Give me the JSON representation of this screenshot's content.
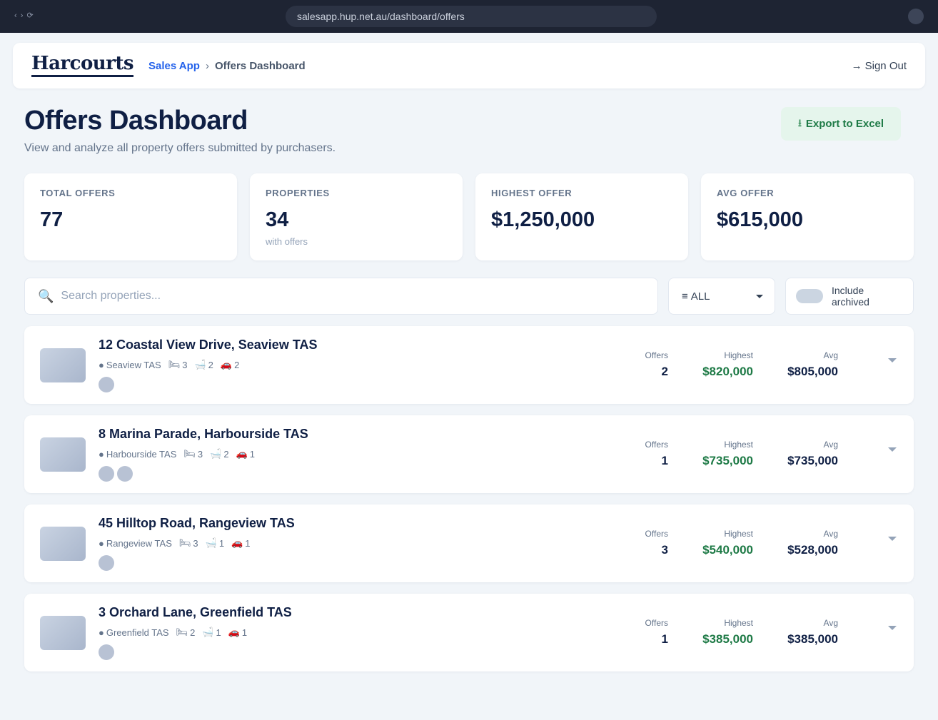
{
  "browser": {
    "nav": "‹ › ⟳",
    "url": "salesapp.hup.net.au/dashboard/offers"
  },
  "header": {
    "logo": "Harcourts",
    "breadcrumb": {
      "root": "Sales App",
      "separator": "›",
      "current": "Offers Dashboard"
    },
    "signout_icon": "→",
    "signout_label": "Sign Out"
  },
  "page": {
    "title": "Offers Dashboard",
    "subtitle": "View and analyze all property offers submitted by purchasers.",
    "export_icon": "⭳",
    "export_label": "Export to Excel"
  },
  "stats": [
    {
      "label": "Total Offers",
      "value": "77",
      "sub": ""
    },
    {
      "label": "Properties",
      "value": "34",
      "sub": "with offers"
    },
    {
      "label": "Highest Offer",
      "value": "$1,250,000",
      "sub": ""
    },
    {
      "label": "Avg Offer",
      "value": "$615,000",
      "sub": ""
    }
  ],
  "search": {
    "icon": "🔍",
    "placeholder": "Search properties...",
    "value": ""
  },
  "filter": {
    "icon": "≡",
    "selected": "ALL"
  },
  "archived": {
    "label": "Include archived",
    "enabled": false
  },
  "metric_labels": {
    "offers": "Offers",
    "highest": "Highest",
    "avg": "Avg"
  },
  "icons": {
    "bed": "🛏",
    "bath": "🛁",
    "car": "🚗",
    "suburb_dot": "●"
  },
  "properties": [
    {
      "title": "12 Coastal View Drive, Seaview TAS",
      "suburb": "Seaview TAS",
      "beds": "3",
      "baths": "2",
      "cars": "2",
      "offers": "2",
      "highest": "$820,000",
      "avg": "$805,000",
      "agents": 1
    },
    {
      "title": "8 Marina Parade, Harbourside TAS",
      "suburb": "Harbourside TAS",
      "beds": "3",
      "baths": "2",
      "cars": "1",
      "offers": "1",
      "highest": "$735,000",
      "avg": "$735,000",
      "agents": 2
    },
    {
      "title": "45 Hilltop Road, Rangeview TAS",
      "suburb": "Rangeview TAS",
      "beds": "3",
      "baths": "1",
      "cars": "1",
      "offers": "3",
      "highest": "$540,000",
      "avg": "$528,000",
      "agents": 1
    },
    {
      "title": "3 Orchard Lane, Greenfield TAS",
      "suburb": "Greenfield TAS",
      "beds": "2",
      "baths": "1",
      "cars": "1",
      "offers": "1",
      "highest": "$385,000",
      "avg": "$385,000",
      "agents": 1
    }
  ]
}
